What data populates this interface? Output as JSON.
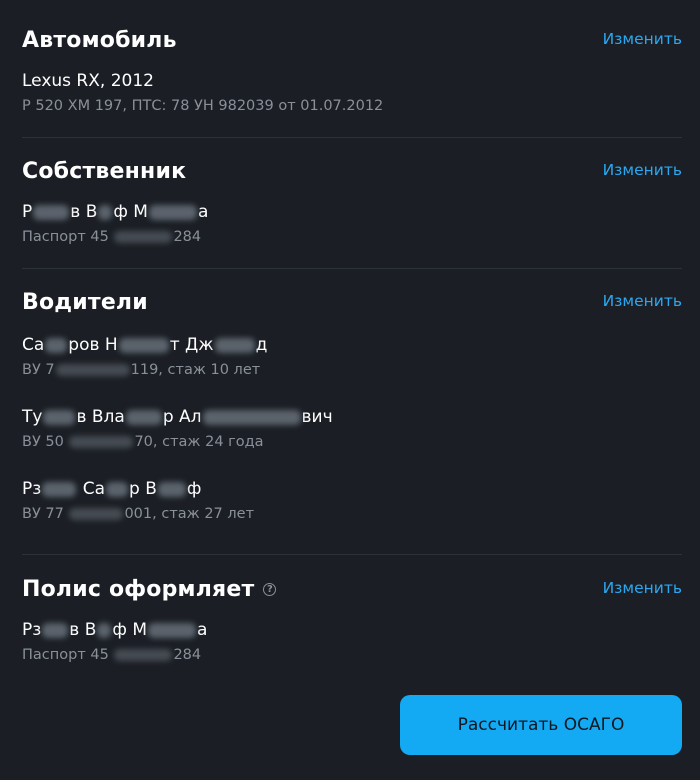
{
  "car": {
    "title": "Автомобиль",
    "edit": "Изменить",
    "name": "Lexus RX, 2012",
    "details": "Р 520 ХМ 197, ПТС: 78 УН 982039 от 01.07.2012"
  },
  "owner": {
    "title": "Собственник",
    "edit": "Изменить",
    "name_parts": [
      "Р",
      "в В",
      "ф М",
      "а"
    ],
    "doc_parts": [
      "Паспорт 45",
      "284"
    ]
  },
  "drivers": {
    "title": "Водители",
    "edit": "Изменить",
    "items": [
      {
        "name_parts": [
          "Са",
          "ров Н",
          "т Дж",
          "д"
        ],
        "license_parts": [
          "ВУ 7",
          "119, стаж 10 лет"
        ]
      },
      {
        "name_parts": [
          "Ту",
          "в Вла",
          "р Ал",
          "вич"
        ],
        "license_parts": [
          "ВУ 50",
          "70, стаж 24 года"
        ]
      },
      {
        "name_parts": [
          "Рз",
          "Са",
          "р В",
          "ф"
        ],
        "license_parts": [
          "ВУ 77",
          "001, стаж 27 лет"
        ]
      }
    ]
  },
  "policyholder": {
    "title": "Полис оформляет",
    "help_icon": "question-circle-icon",
    "edit": "Изменить",
    "name_parts": [
      "Рз",
      "в В",
      "ф М",
      "а"
    ],
    "doc_parts": [
      "Паспорт 45",
      "284"
    ]
  },
  "action": {
    "calculate_label": "Рассчитать ОСАГО"
  },
  "colors": {
    "background": "#1b1f25",
    "accent": "#13aaf3",
    "link": "#2aa8f2",
    "muted_text": "#8a9099"
  }
}
